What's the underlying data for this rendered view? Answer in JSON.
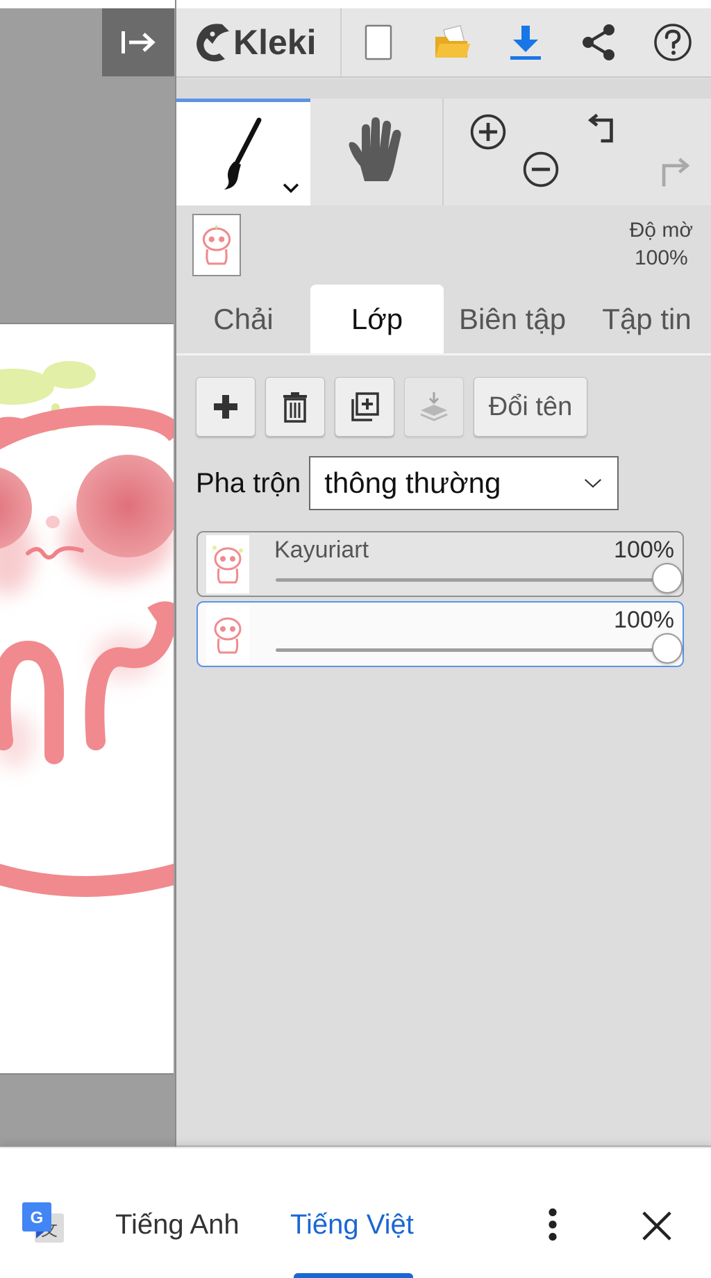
{
  "app": {
    "logo_text": "Kleki",
    "colors": {
      "accent": "#5b93e6",
      "download": "#1976e6",
      "folder": "#f0b428",
      "translate_blue": "#1a67d2"
    }
  },
  "toolbar": {
    "buttons": [
      {
        "icon": "new-document-icon"
      },
      {
        "icon": "open-folder-icon"
      },
      {
        "icon": "download-icon"
      },
      {
        "icon": "share-icon"
      },
      {
        "icon": "help-icon"
      }
    ]
  },
  "tools": {
    "brush": {
      "icon": "brush-icon",
      "selected": true
    },
    "hand": {
      "icon": "hand-icon"
    },
    "zoom": {
      "in_icon": "zoom-in-icon",
      "out_icon": "zoom-out-icon"
    },
    "history": {
      "undo_icon": "undo-icon",
      "redo_icon": "redo-icon"
    }
  },
  "preview": {
    "opacity_label": "Độ mờ",
    "opacity_value": "100%"
  },
  "tabs": [
    {
      "label": "Chải",
      "active": false
    },
    {
      "label": "Lớp",
      "active": true
    },
    {
      "label": "Biên tập",
      "active": false
    },
    {
      "label": "Tập tin",
      "active": false
    }
  ],
  "layer_actions": {
    "add_icon": "plus-icon",
    "delete_icon": "trash-icon",
    "duplicate_icon": "duplicate-icon",
    "merge_icon": "merge-down-icon",
    "rename_label": "Đổi tên"
  },
  "blend": {
    "label": "Pha trộn",
    "value": "thông thường"
  },
  "layers": [
    {
      "name": "Kayuriart",
      "opacity_text": "100%",
      "opacity": 1.0,
      "selected": false
    },
    {
      "name": "",
      "opacity_text": "100%",
      "opacity": 1.0,
      "selected": true
    }
  ],
  "translate_bar": {
    "source_lang": "Tiếng Anh",
    "target_lang": "Tiếng Việt",
    "active": "target"
  }
}
